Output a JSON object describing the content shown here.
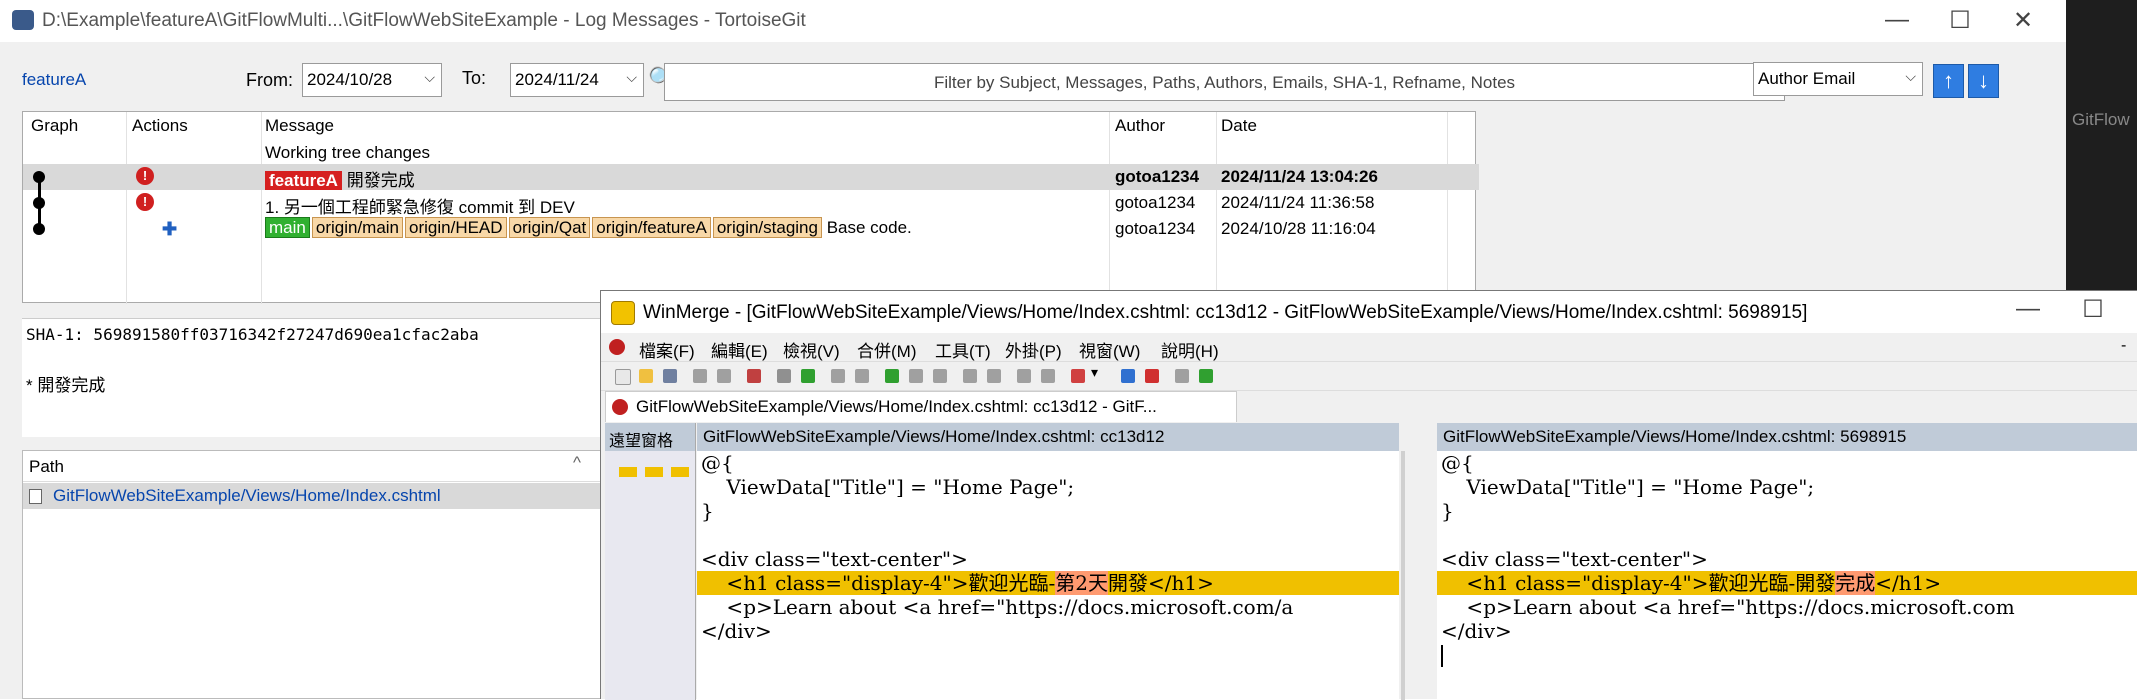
{
  "tortoisegit": {
    "title": "D:\\Example\\featureA\\GitFlowMulti...\\GitFlowWebSiteExample - Log Messages - TortoiseGit",
    "branch_link": "featureA",
    "from_label": "From:",
    "from_value": "2024/10/28",
    "to_label": "To:",
    "to_value": "2024/11/24",
    "filter_placeholder": "Filter by Subject, Messages, Paths, Authors, Emails, SHA-1, Refname, Notes",
    "filter_field_value": "Author Email",
    "columns": [
      "Graph",
      "Actions",
      "Message",
      "Author",
      "Date"
    ],
    "rows": [
      {
        "message": "Working tree changes",
        "author": "",
        "date": ""
      },
      {
        "tags": [
          "featureA"
        ],
        "message": "開發完成",
        "author": "gotoa1234",
        "date": "2024/11/24 13:04:26"
      },
      {
        "message": "1. 另一個工程師緊急修復 commit 到 DEV",
        "author": "gotoa1234",
        "date": "2024/11/24 11:36:58"
      },
      {
        "tags": [
          "main",
          "origin/main",
          "origin/HEAD",
          "origin/Qat",
          "origin/featureA",
          "origin/staging"
        ],
        "message": "Base code.",
        "author": "gotoa1234",
        "date": "2024/10/28 11:16:04"
      }
    ],
    "details_sha": "SHA-1: 569891580ff03716342f27247d690ea1cfac2aba",
    "details_msg": "* 開發完成",
    "path_header": "Path",
    "path_item": "GitFlowWebSiteExample/Views/Home/Index.cshtml",
    "right_edge_text": "GitFlow"
  },
  "winmerge": {
    "title": "WinMerge - [GitFlowWebSiteExample/Views/Home/Index.cshtml: cc13d12 - GitFlowWebSiteExample/Views/Home/Index.cshtml: 5698915]",
    "menu": [
      "檔案(F)",
      "編輯(E)",
      "檢視(V)",
      "合併(M)",
      "工具(T)",
      "外掛(P)",
      "視窗(W)",
      "說明(H)"
    ],
    "tab_title": "GitFlowWebSiteExample/Views/Home/Index.cshtml: cc13d12 - GitF...",
    "location_pane_label": "遠望窗格",
    "left_header": "GitFlowWebSiteExample/Views/Home/Index.cshtml: cc13d12",
    "right_header": "GitFlowWebSiteExample/Views/Home/Index.cshtml: 5698915",
    "left_lines": [
      "@{",
      "    ViewData[\"Title\"] = \"Home Page\";",
      "}",
      "",
      "<div class=\"text-center\">",
      "    <h1 class=\"display-4\">歡迎光臨-",
      "第2天",
      "開發</h1>",
      "    <p>Learn about <a href=\"https://docs.microsoft.com/a",
      "</div>"
    ],
    "right_lines": [
      "@{",
      "    ViewData[\"Title\"] = \"Home Page\";",
      "}",
      "",
      "<div class=\"text-center\">",
      "    <h1 class=\"display-4\">歡迎光臨-開發",
      "完成",
      "</h1>",
      "    <p>Learn about <a href=\"https://docs.microsoft.com",
      "</div>"
    ]
  },
  "colors": {
    "accent": "#2f7de1",
    "diff": "#f0c000",
    "diff_word": "#ff9a70"
  }
}
